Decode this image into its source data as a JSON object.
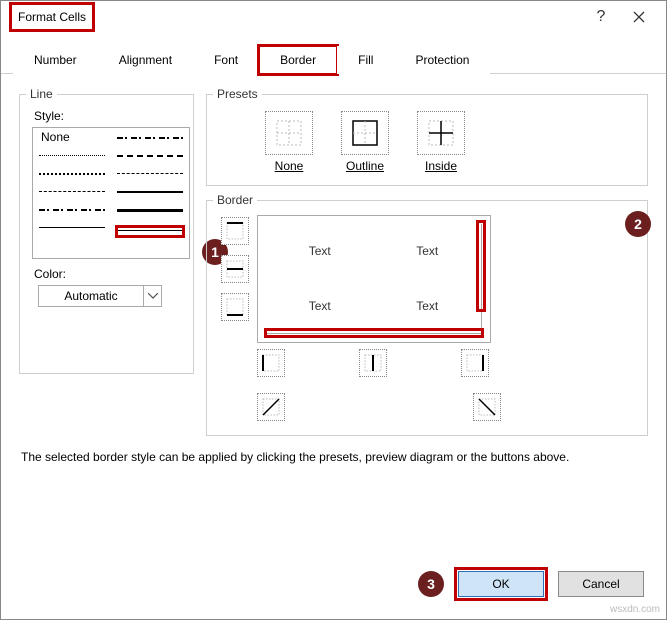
{
  "window": {
    "title": "Format Cells",
    "help_label": "?",
    "close_label": "✕"
  },
  "tabs": {
    "number": "Number",
    "alignment": "Alignment",
    "font": "Font",
    "border": "Border",
    "fill": "Fill",
    "protection": "Protection"
  },
  "line": {
    "legend": "Line",
    "style_label": "Style:",
    "none": "None",
    "color_label": "Color:",
    "color_value": "Automatic"
  },
  "presets": {
    "legend": "Presets",
    "none": "None",
    "outline": "Outline",
    "inside": "Inside"
  },
  "border": {
    "legend": "Border",
    "cell_text": "Text"
  },
  "description": "The selected border style can be applied by clicking the presets, preview diagram or the buttons above.",
  "buttons": {
    "ok": "OK",
    "cancel": "Cancel"
  },
  "annotations": {
    "badge1": "1",
    "badge2": "2",
    "badge3": "3"
  },
  "watermark": "wsxdn.com"
}
